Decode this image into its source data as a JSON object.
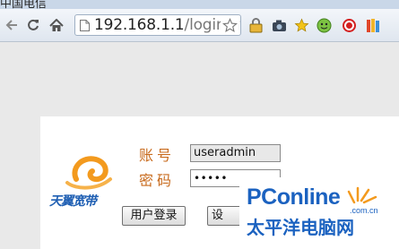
{
  "tab": {
    "title": "中国电信"
  },
  "address_bar": {
    "host": "192.168.1.1",
    "path": "/login.htm"
  },
  "icons": {
    "back": "back-arrow-icon",
    "reload": "reload-icon",
    "home": "home-icon",
    "page": "page-icon",
    "bookmark": "star-icon",
    "extensions": [
      "lock-extension-icon",
      "camera-extension-icon",
      "star-extension-icon",
      "green-face-extension-icon",
      "red-circle-extension-icon",
      "books-extension-icon"
    ]
  },
  "login": {
    "logo_text": "天翼宽带",
    "username_label": "账号",
    "username_value": "useradmin",
    "password_label": "密码",
    "password_value": "•••••",
    "login_button": "用户登录",
    "second_button": "设"
  },
  "watermark": {
    "brand": "PConline",
    "domain": ".com.cn",
    "chinese": "太平洋电脑网"
  },
  "colors": {
    "label": "#c86b1e",
    "watermark": "#1b62c0",
    "logo_blue": "#1f5fb3",
    "logo_orange": "#f39a1e"
  }
}
